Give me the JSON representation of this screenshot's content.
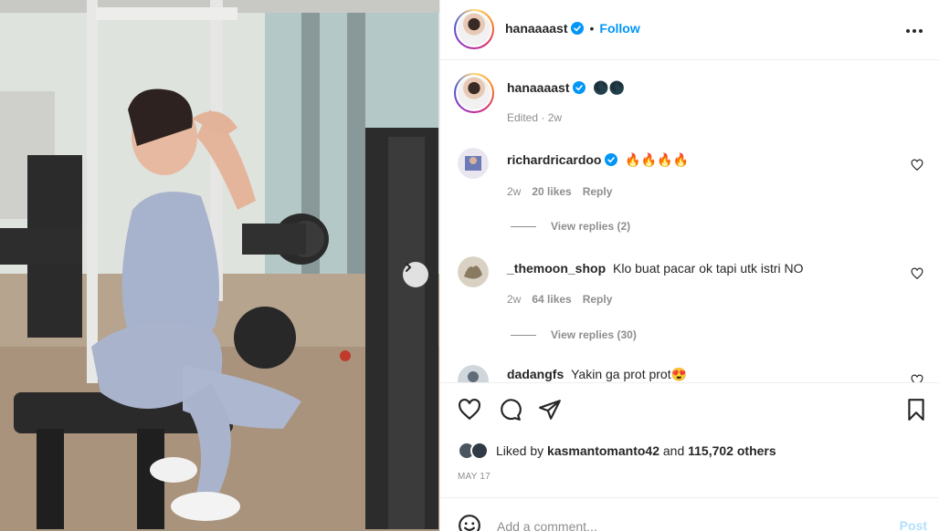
{
  "post": {
    "username": "hanaaaast",
    "follow_label": "Follow",
    "separator": "•",
    "caption": "🌑🌑",
    "edited": "Edited · 2w",
    "media_next": "›"
  },
  "comments": [
    {
      "username": "richardricardoo",
      "verified": true,
      "text": "🔥🔥🔥🔥",
      "time": "2w",
      "likes": "20 likes",
      "reply": "Reply",
      "view_replies": "View replies (2)"
    },
    {
      "username": "_themoon_shop",
      "verified": false,
      "text": "Klo buat pacar ok tapi utk istri NO",
      "time": "2w",
      "likes": "64 likes",
      "reply": "Reply",
      "view_replies": "View replies (30)"
    },
    {
      "username": "dadangfs",
      "verified": false,
      "text": "Yakin ga prot prot😍",
      "time": "",
      "likes": "",
      "reply": "",
      "view_replies": ""
    }
  ],
  "likes": {
    "prefix": "Liked by",
    "user": "kasmantomanto42",
    "conj": "and",
    "others": "115,702 others"
  },
  "date": "MAY 17",
  "add_comment": {
    "placeholder": "Add a comment...",
    "post_label": "Post"
  },
  "icons": {
    "more": "more-horizontal-icon",
    "verified": "verified-badge-icon",
    "like": "heart-icon",
    "comment": "comment-bubble-icon",
    "share": "paper-plane-icon",
    "save": "bookmark-icon",
    "emoji": "smiley-icon"
  },
  "colors": {
    "accent": "#0095f6",
    "text": "#262626",
    "muted": "#8e8e8e",
    "border": "#efefef",
    "post_disabled": "#b2dffc"
  }
}
